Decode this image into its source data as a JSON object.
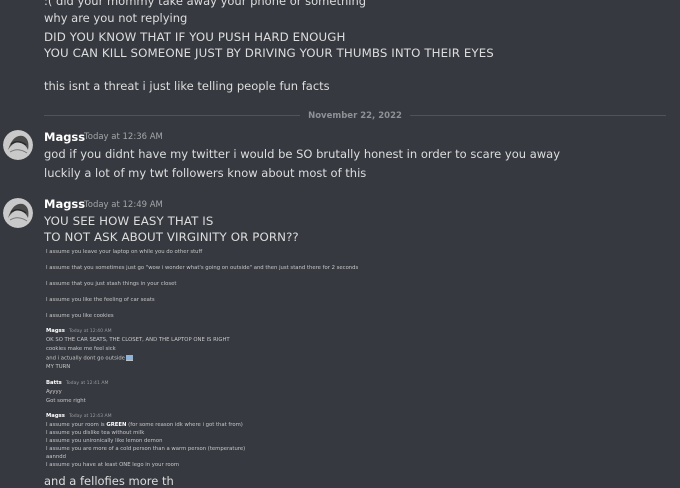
{
  "top_messages": [
    ":( did your mommy take away your phone or something",
    "why are you not replying",
    "DID YOU KNOW THAT IF YOU PUSH HARD ENOUGH",
    "YOU CAN KILL SOMEONE JUST BY DRIVING YOUR THUMBS INTO THEIR EYES",
    "this isnt a threat i just like telling people fun facts"
  ],
  "date_divider": "November 22, 2022",
  "group1": {
    "author": "Magss",
    "timestamp": "Today at 12:36 AM",
    "lines": [
      "god if you didnt have my twitter i would be SO brutally honest in order to scare you away",
      "luckily a lot of my twt followers know about most of this"
    ]
  },
  "group2": {
    "author": "Magss",
    "timestamp": "Today at 12:49 AM",
    "lines": [
      "YOU SEE HOW EASY THAT IS",
      "TO NOT ASK ABOUT VIRGINITY OR PORN??"
    ]
  },
  "screenshot": {
    "lines_a": [
      "I assume you leave your laptop on while you do other stuff",
      "I assume that you sometimes just go \"wow i wonder what's going on outside\" and then just stand there for 2 seconds",
      "I assume that you just stash things in your closet",
      "I assume you like the feeling of car seats",
      "I assume you like cookies"
    ],
    "magss1": {
      "author": "Magss",
      "timestamp": "Today at 12:40 AM",
      "lines": [
        "OK SO THE CAR SEATS, THE CLOSET, AND THE LAPTOP ONE IS RIGHT",
        "cookies make me feel sick",
        "and i actually dont go outside",
        "MY TURN"
      ]
    },
    "batts": {
      "author": "Batts",
      "timestamp": "Today at 12:41 AM",
      "lines": [
        "Ayyyy",
        "Got some right"
      ]
    },
    "magss2": {
      "author": "Magss",
      "timestamp": "Today at 12:43 AM",
      "line1_prefix": "I assume your room is ",
      "line1_bold": "GREEN",
      "line1_suffix": " (for some reason idk where i got that from)",
      "lines": [
        "I assume you dislike tea without milk",
        "I assume you unironically like lemon demon",
        "I assume you are more of a cold person than a warm person (temperature)",
        "aanndd",
        "I assume you have at least ONE lego in your room"
      ]
    }
  },
  "cutoff_text": "and a fellofies more th"
}
